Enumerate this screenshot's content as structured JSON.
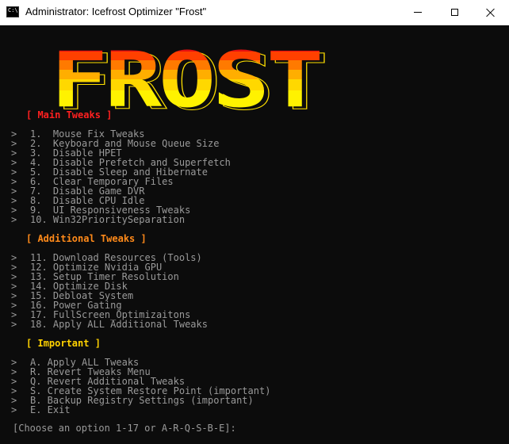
{
  "window": {
    "title": "Administrator:  Icefrost Optimizer \"Frost\"",
    "icon_text": "C:\\."
  },
  "logo": {
    "text": "FROST",
    "letters": [
      "F",
      "R",
      "O",
      "S",
      "T"
    ]
  },
  "sections": {
    "main": {
      "header": "[ Main Tweaks ]",
      "items": [
        "1.  Mouse Fix Tweaks",
        "2.  Keyboard and Mouse Queue Size",
        "3.  Disable HPET",
        "4.  Disable Prefetch and Superfetch",
        "5.  Disable Sleep and Hibernate",
        "6.  Clear Temporary Files",
        "7.  Disable Game DVR",
        "8.  Disable CPU Idle",
        "9.  UI Responsiveness Tweaks",
        "10. Win32PrioritySeparation"
      ]
    },
    "additional": {
      "header": "[ Additional Tweaks ]",
      "items": [
        "11. Download Resources (Tools)",
        "12. Optimize Nvidia GPU",
        "13. Setup Timer Resolution",
        "14. Optimize Disk",
        "15. Debloat System",
        "16. Power Gating",
        "17. FullScreen_Optimizaitons",
        "18. Apply ALL Additional Tweaks"
      ]
    },
    "important": {
      "header": "[ Important ]",
      "items": [
        "A. Apply ALL Tweaks",
        "R. Revert Tweaks Menu",
        "Q. Revert Additional Tweaks",
        "S. Create System Restore Point (important)",
        "B. Backup Registry Settings (important)",
        "E. Exit"
      ]
    }
  },
  "arrow_glyph": ">",
  "prompt": "[Choose an option 1-17 or A-R-Q-S-B-E]:",
  "colors": {
    "background": "#0c0c0c",
    "text": "#9a9a9a",
    "main_header": "#ff2020",
    "additional_header": "#ff8a1a",
    "important_header": "#ffd200"
  }
}
